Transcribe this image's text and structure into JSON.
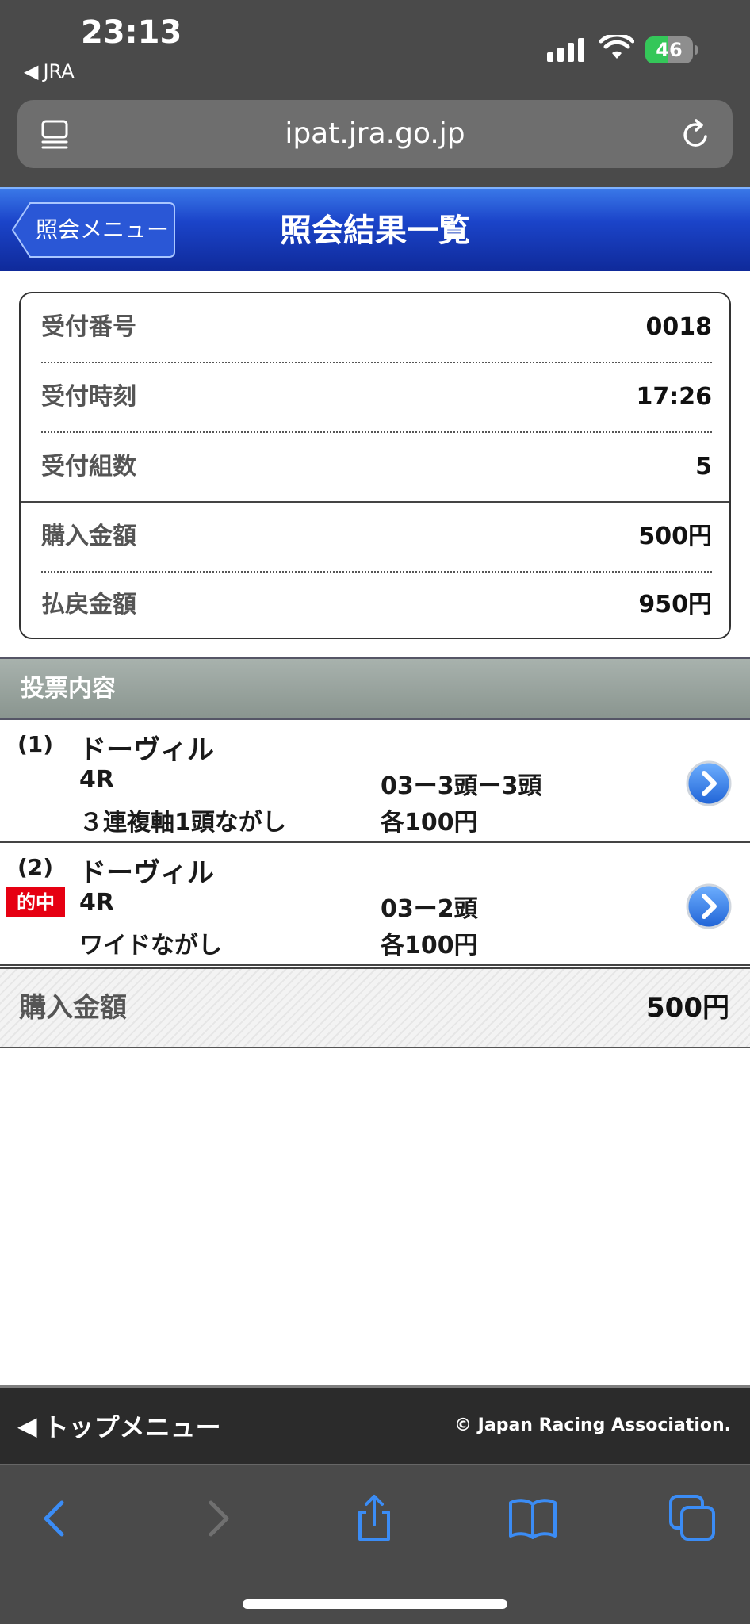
{
  "status_bar": {
    "time": "23:13",
    "back_app": "JRA",
    "battery_level": "46",
    "battery_fraction": 0.46
  },
  "browser": {
    "url": "ipat.jra.go.jp"
  },
  "header": {
    "back_label": "照会メニュー",
    "title": "照会結果一覧"
  },
  "summary": {
    "rows": [
      {
        "label": "受付番号",
        "value": "0018"
      },
      {
        "label": "受付時刻",
        "value": "17:26"
      },
      {
        "label": "受付組数",
        "value": "5"
      },
      {
        "label": "購入金額",
        "value": "500円"
      },
      {
        "label": "払戻金額",
        "value": "950円"
      }
    ]
  },
  "bets": {
    "section_title": "投票内容",
    "items": [
      {
        "index": "(1)",
        "venue": "ドーヴィル",
        "race": "4R",
        "type": "３連複軸1頭ながし",
        "combo": "03ー3頭ー3頭",
        "amount": "各100円",
        "badge": ""
      },
      {
        "index": "(2)",
        "venue": "ドーヴィル",
        "race": "4R",
        "type": "ワイドながし",
        "combo": "03ー2頭",
        "amount": "各100円",
        "badge": "的中"
      }
    ]
  },
  "total": {
    "label": "購入金額",
    "value": "500円"
  },
  "footer": {
    "top_menu": "トップメニュー",
    "copyright": "© Japan Racing Association."
  },
  "colors": {
    "header_blue": "#1b44c9",
    "hit_red": "#e60012",
    "ios_blue": "#3b8cf5"
  },
  "icons": [
    "tabs-icon",
    "reload-icon",
    "chevron-right-icon",
    "back-icon",
    "forward-icon",
    "share-icon",
    "bookmarks-icon",
    "tabs-overview-icon"
  ]
}
